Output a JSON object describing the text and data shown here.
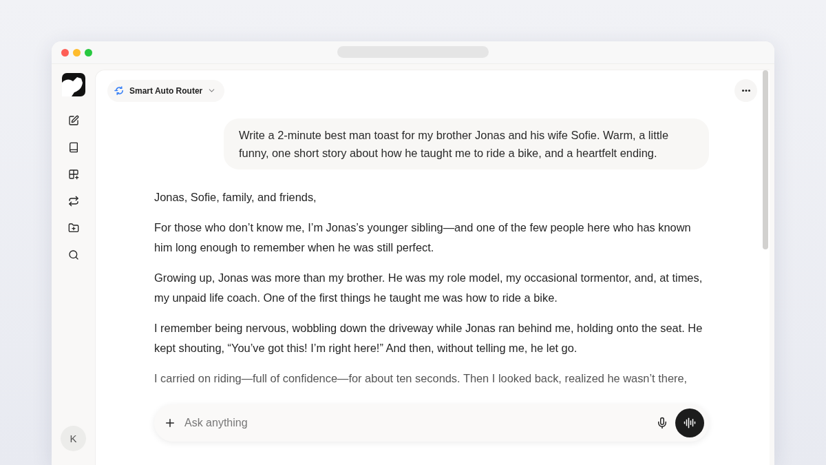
{
  "sidebar": {
    "avatar": "K"
  },
  "model_selector": {
    "label": "Smart Auto Router"
  },
  "user_message": "Write a 2-minute best man toast for my brother Jonas and his wife Sofie. Warm, a little funny, one short story about how he taught me to ride a bike, and a heartfelt ending.",
  "response": {
    "paragraphs": [
      "Jonas, Sofie, family, and friends,",
      "For those who don’t know me, I’m Jonas’s younger sibling—and one of the few people here who has known him long enough to remember when he was still perfect.",
      "Growing up, Jonas was more than my brother. He was my role model, my occasional tormentor, and, at times, my unpaid life coach. One of the first things he taught me was how to ride a bike.",
      "I remember being nervous, wobbling down the driveway while Jonas ran behind me, holding onto the seat. He kept shouting, “You’ve got this! I’m right here!” And then, without telling me, he let go.",
      "I carried on riding—full of confidence—for about ten seconds. Then I looked back, realized he wasn’t there,"
    ]
  },
  "composer": {
    "placeholder": "Ask anything"
  }
}
